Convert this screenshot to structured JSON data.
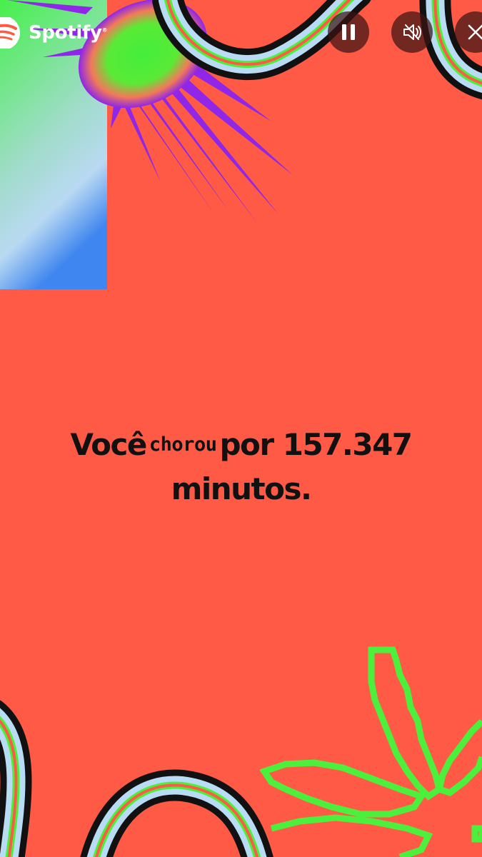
{
  "app": {
    "brand": "Spotify",
    "brand_mark": "®"
  },
  "controls": {
    "pause_icon": "pause-icon",
    "mute_icon": "speaker-muted-icon",
    "close_icon": "close-icon"
  },
  "story": {
    "line1_prefix": "Você",
    "line1_highlight": "chorou",
    "line1_suffix": "por 157.347",
    "line2": "minutos."
  },
  "colors": {
    "background": "#ff5a45",
    "text": "#111111",
    "accent_green": "#4cf03c",
    "accent_purple": "#8f26e8",
    "control_bg": "#4a1a1a"
  }
}
